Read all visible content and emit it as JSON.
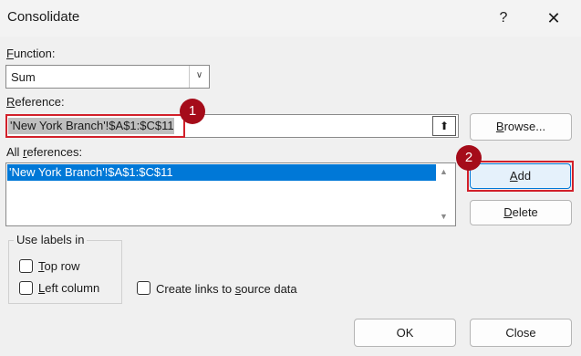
{
  "window": {
    "title": "Consolidate",
    "help_label": "?",
    "close_glyph": "✕"
  },
  "function": {
    "label_pre": "",
    "label_ul": "F",
    "label_post": "unction:",
    "value": "Sum"
  },
  "reference": {
    "label_pre": "",
    "label_ul": "R",
    "label_post": "eference:",
    "value": "'New York Branch'!$A$1:$C$11",
    "collapse_glyph": "⬆"
  },
  "browse": {
    "pre": "",
    "ul": "B",
    "post": "rowse..."
  },
  "all_refs": {
    "label_pre": "All ",
    "label_ul": "r",
    "label_post": "eferences:",
    "items": [
      "'New York Branch'!$A$1:$C$11"
    ]
  },
  "add": {
    "pre": "",
    "ul": "A",
    "post": "dd"
  },
  "delete": {
    "pre": "",
    "ul": "D",
    "post": "elete"
  },
  "labels_group": {
    "title": "Use labels in",
    "top_row": {
      "pre": "",
      "ul": "T",
      "post": "op row",
      "checked": false
    },
    "left_column": {
      "pre": "",
      "ul": "L",
      "post": "eft column",
      "checked": false
    }
  },
  "links": {
    "pre": "Create links to ",
    "ul": "s",
    "post": "ource data",
    "checked": false
  },
  "ok_label": "OK",
  "close_label": "Close",
  "annotations": {
    "badge1": "1",
    "badge2": "2",
    "highlight_color": "#d2202a",
    "badge_color": "#a50c1a"
  },
  "colors": {
    "selection": "#0078d7",
    "dialog_bg": "#f0f0f0"
  }
}
